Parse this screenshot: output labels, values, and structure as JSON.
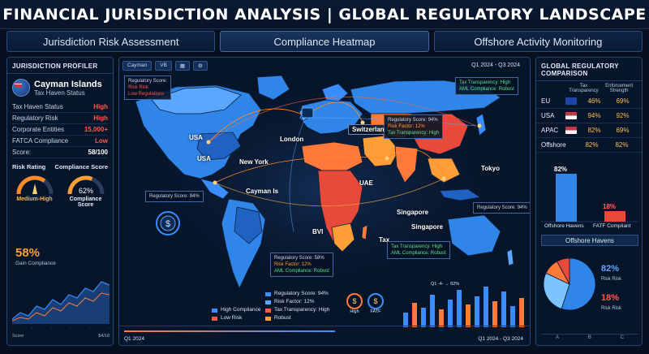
{
  "title": "FINANCIAL JURISDICTION ANALYSIS | GLOBAL REGULATORY LANDSCAPE",
  "tabs": [
    {
      "label": "Jurisdiction Risk Assessment"
    },
    {
      "label": "Compliance Heatmap"
    },
    {
      "label": "Offshore Activity Monitoring"
    }
  ],
  "profiler": {
    "heading": "JURISDICTION PROFILER",
    "name": "Cayman Islands",
    "subtitle": "Tax Haven Status",
    "rows": [
      {
        "key": "Tax Haven Status",
        "value": "High"
      },
      {
        "key": "Regulatory Risk",
        "value": "High"
      },
      {
        "key": "Corporate Entities",
        "value": "15,000+"
      },
      {
        "key": "FATCA Compliance",
        "value": "Low"
      },
      {
        "key": "Score:",
        "value": "58/100"
      }
    ],
    "risk_rating_label": "Risk Rating",
    "compliance_score_label": "Compliance Score",
    "risk_gauge_value": "Medium-High",
    "risk_gauge_fraction": 0.7,
    "compliance_pct": "62%",
    "compliance_fraction": 0.62,
    "compliance_footer": "Compliance Score",
    "trend_pct": "58%",
    "trend_label": "Gain Compliance",
    "footer_left": "Score",
    "footer_right": "$4/18"
  },
  "map": {
    "btn_a": "Cayman",
    "btn_b": "VB",
    "period": "Q1 2024  -  Q3 2024",
    "cities": {
      "usa": "USA",
      "usa2": "USA",
      "london": "London",
      "switzerland": "Switzerland",
      "new_york": "New York",
      "cayman": "Cayman Is",
      "tokyo": "Tokyo",
      "singapore": "Singapore",
      "singapore2": "Singapore",
      "uae": "UAE",
      "bvi": "BVI",
      "tax": "Tax"
    },
    "info_top_left": {
      "l1": "Regulatory Score:",
      "l2": "Risk Risk",
      "l3": "Low Regulations"
    },
    "info_top_right": {
      "l1": "Tax Transparency: High",
      "l2": "AML Compliance: Robust"
    },
    "info_switz": {
      "l1": "Regulatory Score: 94%",
      "l2": "Risk Factor: 12%",
      "l3": "Tax Transparency: High"
    },
    "info_west": "Regulatory Score: 94%",
    "info_east": "Regulatory Score: 94%",
    "info_tax": {
      "l1": "Tax Transparency: High",
      "l2": "AML Compliance: Robust"
    },
    "info_bvi": {
      "l1": "Regulatory Score: 58%",
      "l2": "Risk Factor: 12%",
      "l3": "AML Compliance: Robust"
    },
    "legend": [
      {
        "label": "High Compliance",
        "color": "#3a8dff"
      },
      {
        "label": "Low Risk",
        "color": "#ff5a4a"
      }
    ],
    "legend2": [
      {
        "label": "Regulatory Score: 94%",
        "color": "#3a8dff"
      },
      {
        "label": "Risk Factor: 12%",
        "color": "#5aa7ff"
      },
      {
        "label": "Tax Transparency: High",
        "color": "#ff5a4a"
      },
      {
        "label": "Robust",
        "color": "#ff9d36"
      }
    ],
    "mini_a": "High",
    "mini_b": "FATF",
    "bars_legend": "Q1 -4-  → 82%",
    "footer_left": "Q1 2024",
    "footer_right": "Q1 2024 - Q3 2024"
  },
  "comparison": {
    "heading": "GLOBAL REGULATORY COMPARISON",
    "col_a": "Tax Transparency",
    "col_b": "Enforcement Strength",
    "rows": [
      {
        "name": "EU",
        "a": "46%",
        "b": "69%",
        "flag": "#1e46a6"
      },
      {
        "name": "USA",
        "a": "94%",
        "b": "92%",
        "flag": "#c5364a"
      },
      {
        "name": "APAC",
        "a": "82%",
        "b": "69%",
        "flag": "#c5364a"
      },
      {
        "name": "Offshore",
        "a": "82%",
        "b": "82%",
        "flag": ""
      }
    ],
    "bar_a_label": "82%",
    "bar_a_value": 82,
    "bar_b_label": "18%",
    "bar_b_value": 18,
    "bar_a_name": "Offshore Havens",
    "bar_b_name": "FATF Compliant",
    "section_title": "Offshore Havens",
    "pie_a": "82%",
    "pie_a_sub": "Risk Risk",
    "pie_b": "18%",
    "pie_b_sub": "Risk Risk",
    "pie_slices": [
      {
        "value": 55,
        "color": "#2f86e8"
      },
      {
        "value": 27,
        "color": "#7cc4ff"
      },
      {
        "value": 10,
        "color": "#ff7a3a"
      },
      {
        "value": 8,
        "color": "#e84a3a"
      }
    ],
    "foot": [
      "A",
      "B",
      "C"
    ]
  }
}
